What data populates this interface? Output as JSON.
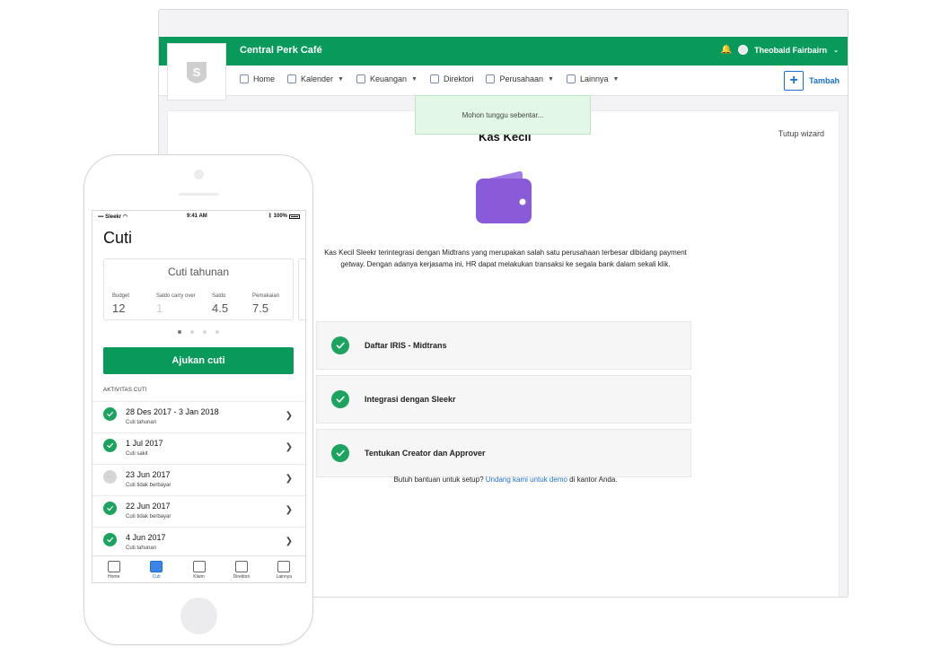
{
  "desktop": {
    "company": "Central Perk Café",
    "user": "Theobald Fairbairn",
    "logo_letter": "S",
    "nav": [
      {
        "label": "Home",
        "dropdown": false
      },
      {
        "label": "Kalender",
        "dropdown": true
      },
      {
        "label": "Keuangan",
        "dropdown": true
      },
      {
        "label": "Direktori",
        "dropdown": false
      },
      {
        "label": "Perusahaan",
        "dropdown": true
      },
      {
        "label": "Lainnya",
        "dropdown": true
      }
    ],
    "add_label": "Tambah",
    "toast": "Mohon tunggu sebentar...",
    "wizard": {
      "title": "Kas Kecil",
      "close": "Tutup wizard",
      "description": "Kas Kecil Sleekr terintegrasi dengan Midtrans yang merupakan salah satu perusahaan terbesar dibidang payment getway. Dengan adanya kerjasama ini, HR dapat melakukan transaksi ke segala bank dalam sekali klik.",
      "steps": [
        "Daftar IRIS - Midtrans",
        "Integrasi dengan Sleekr",
        "Tentukan Creator dan Approver"
      ],
      "help_prefix": "Butuh bantuan untuk setup?",
      "help_link": "Undang kami untuk demo",
      "help_suffix": "di kantor Anda."
    },
    "colors": {
      "brand_green": "#079a5a",
      "link_blue": "#1b6fd1",
      "wallet_purple": "#8a5bd8"
    }
  },
  "mobile": {
    "status": {
      "carrier": "Sleekr",
      "time": "9:41 AM",
      "battery": "100%"
    },
    "title": "Cuti",
    "card": {
      "title": "Cuti tahunan",
      "stats": [
        {
          "label": "Budget",
          "value": "12"
        },
        {
          "label": "Saldo carry over",
          "value": "1"
        },
        {
          "label": "Saldo",
          "value": "4.5"
        },
        {
          "label": "Pemakaian",
          "value": "7.5"
        }
      ]
    },
    "apply_button": "Ajukan cuti",
    "section_title": "AKTIVITAS CUTI",
    "pending_icon": "···",
    "activities": [
      {
        "date": "28 Des 2017 - 3 Jan 2018",
        "type": "Cuti tahunan",
        "status": "approved"
      },
      {
        "date": "1 Jul 2017",
        "type": "Cuti sakit",
        "status": "approved"
      },
      {
        "date": "23 Jun 2017",
        "type": "Cuti tidak berbayar",
        "status": "pending"
      },
      {
        "date": "22 Jun 2017",
        "type": "Cuti tidak berbayar",
        "status": "approved"
      },
      {
        "date": "4 Jun 2017",
        "type": "Cuti tahunan",
        "status": "approved"
      }
    ],
    "tabs": [
      {
        "label": "Home",
        "active": false
      },
      {
        "label": "Cuti",
        "active": true
      },
      {
        "label": "Klaim",
        "active": false
      },
      {
        "label": "Direktori",
        "active": false
      },
      {
        "label": "Lainnya",
        "active": false
      }
    ]
  }
}
